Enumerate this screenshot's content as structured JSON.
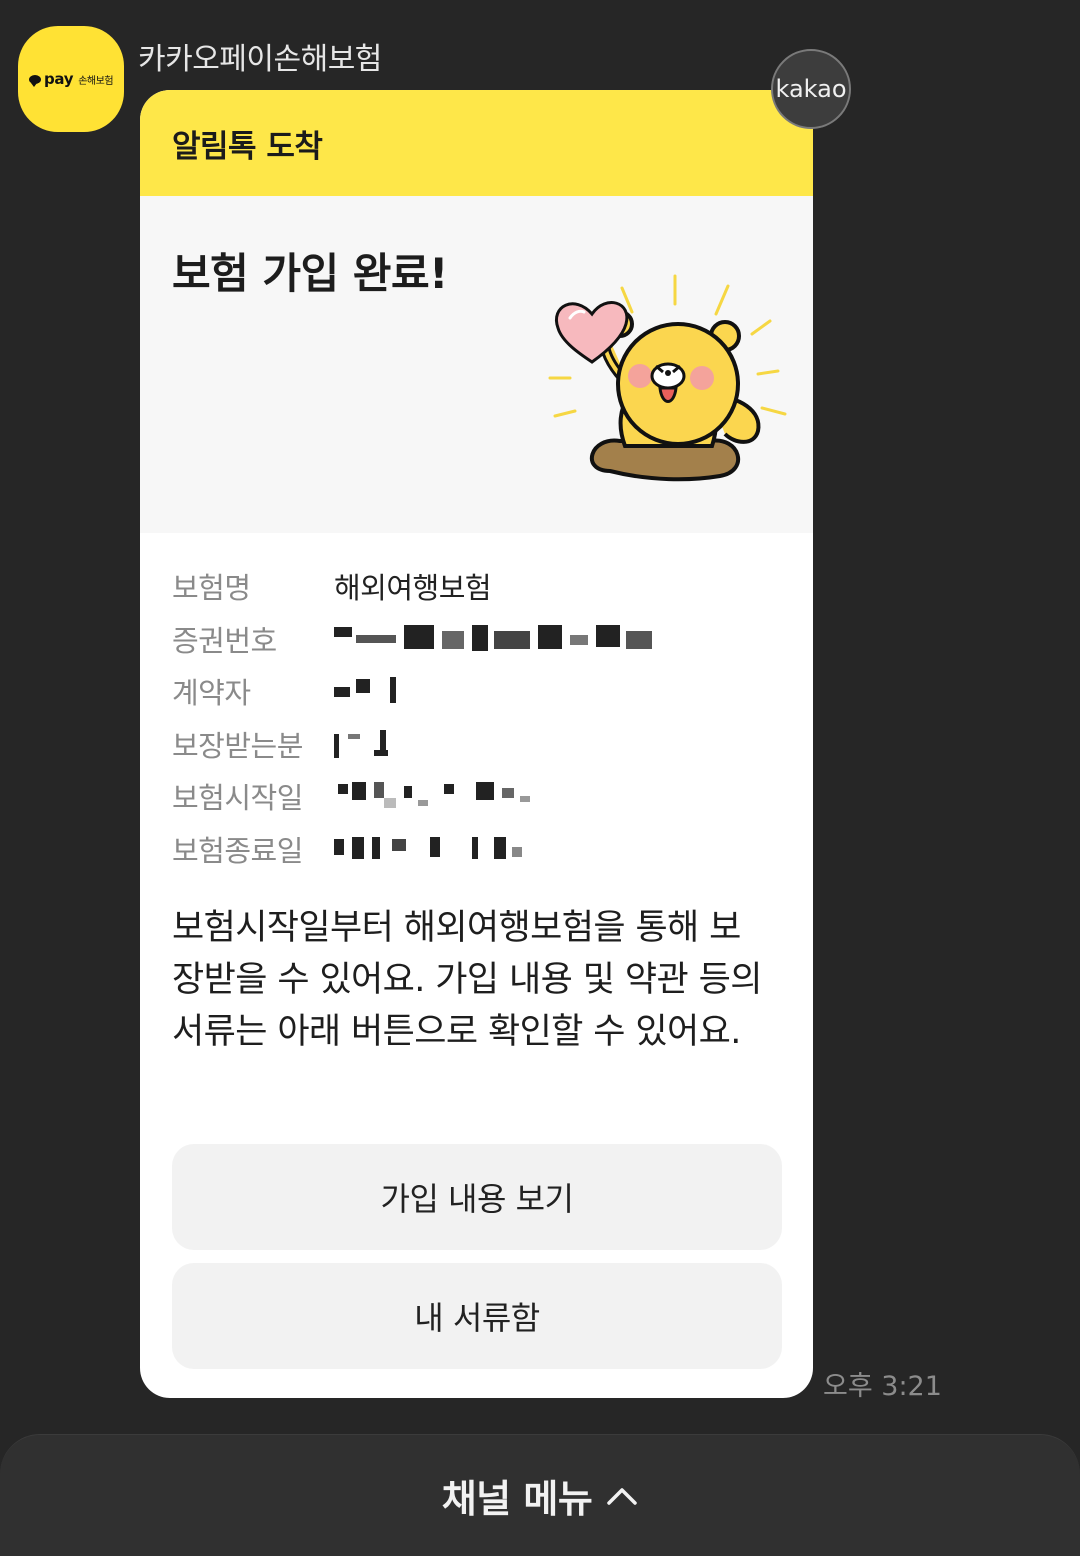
{
  "sender": {
    "name": "카카오페이손해보험",
    "avatar_logo_pay": "pay",
    "avatar_logo_sub": "손해보험",
    "badge": "kakao"
  },
  "card": {
    "header": "알림톡 도착",
    "hero_title": "보험 가입 완료!",
    "info": [
      {
        "label": "보험명",
        "value": "해외여행보험"
      },
      {
        "label": "증권번호",
        "value": ""
      },
      {
        "label": "계약자",
        "value": ""
      },
      {
        "label": "보장받는분",
        "value": ""
      },
      {
        "label": "보험시작일",
        "value": ""
      },
      {
        "label": "보험종료일",
        "value": ""
      }
    ],
    "description": "보험시작일부터 해외여행보험을 통해 보장받을 수 있어요. 가입 내용 및 약관 등의 서류는 아래 버튼으로 확인할 수 있어요.",
    "buttons": [
      {
        "label": "가입 내용 보기"
      },
      {
        "label": "내 서류함"
      }
    ]
  },
  "timestamp": "오후 3:21",
  "bottom_menu": {
    "label": "채널 메뉴"
  },
  "colors": {
    "background": "#262626",
    "header_yellow": "#FEE749",
    "avatar_yellow": "#FFE234"
  },
  "icons": {
    "chevron": "chevron-up-icon"
  }
}
